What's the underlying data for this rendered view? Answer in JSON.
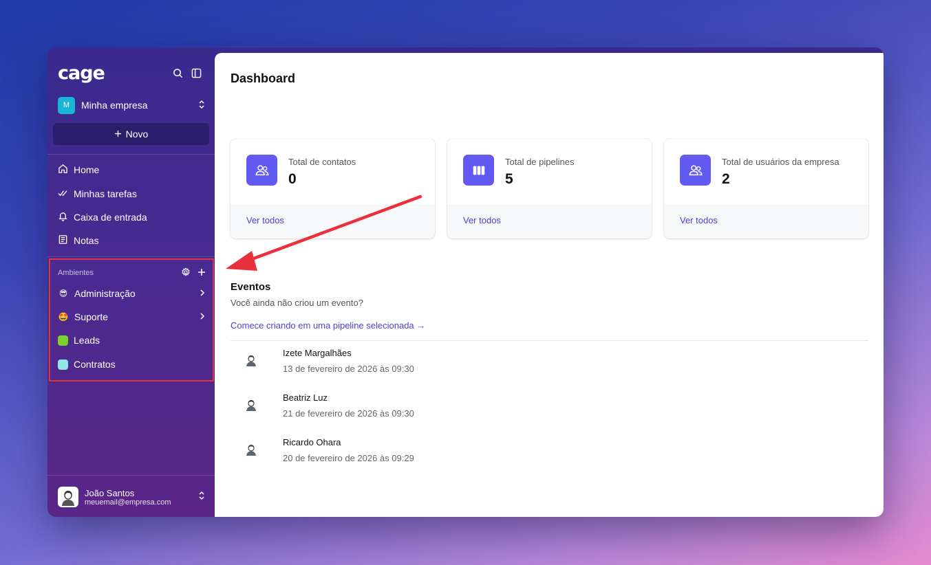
{
  "app": {
    "logo": "cage"
  },
  "company": {
    "badge": "M",
    "name": "Minha empresa"
  },
  "new_button": {
    "label": "Novo"
  },
  "nav": [
    {
      "label": "Home",
      "icon": "home-icon"
    },
    {
      "label": "Minhas tarefas",
      "icon": "checks-icon"
    },
    {
      "label": "Caixa de entrada",
      "icon": "bell-icon"
    },
    {
      "label": "Notas",
      "icon": "notes-icon"
    }
  ],
  "environments": {
    "header": "Ambientes",
    "items": [
      {
        "label": "Administração",
        "marker": "😎",
        "has_children": true
      },
      {
        "label": "Suporte",
        "marker": "🤩",
        "has_children": true
      },
      {
        "label": "Leads",
        "color": "#7ad12a"
      },
      {
        "label": "Contratos",
        "color": "#8ee6e6"
      }
    ]
  },
  "user": {
    "name": "João Santos",
    "email": "meuemail@empresa.com"
  },
  "dashboard": {
    "title": "Dashboard",
    "cards": [
      {
        "label": "Total de contatos",
        "value": "0",
        "link": "Ver todos",
        "icon": "users-icon"
      },
      {
        "label": "Total de pipelines",
        "value": "5",
        "link": "Ver todos",
        "icon": "columns-icon"
      },
      {
        "label": "Total de usuários da empresa",
        "value": "2",
        "link": "Ver todos",
        "icon": "users-icon"
      }
    ],
    "events": {
      "title": "Eventos",
      "empty_text": "Você ainda não criou um evento?",
      "cta": "Comece criando em uma pipeline selecionada →",
      "items": [
        {
          "name": "Izete Margalhães",
          "date": "13 de fevereiro de 2026 às 09:30"
        },
        {
          "name": "Beatriz Luz",
          "date": "21 de fevereiro de 2026 às 09:30"
        },
        {
          "name": "Ricardo Ohara",
          "date": "20 de fevereiro de 2026 às 09:29"
        }
      ]
    }
  },
  "colors": {
    "accent": "#6259f2",
    "link": "#4b3fd8",
    "highlight": "#e2323f"
  }
}
